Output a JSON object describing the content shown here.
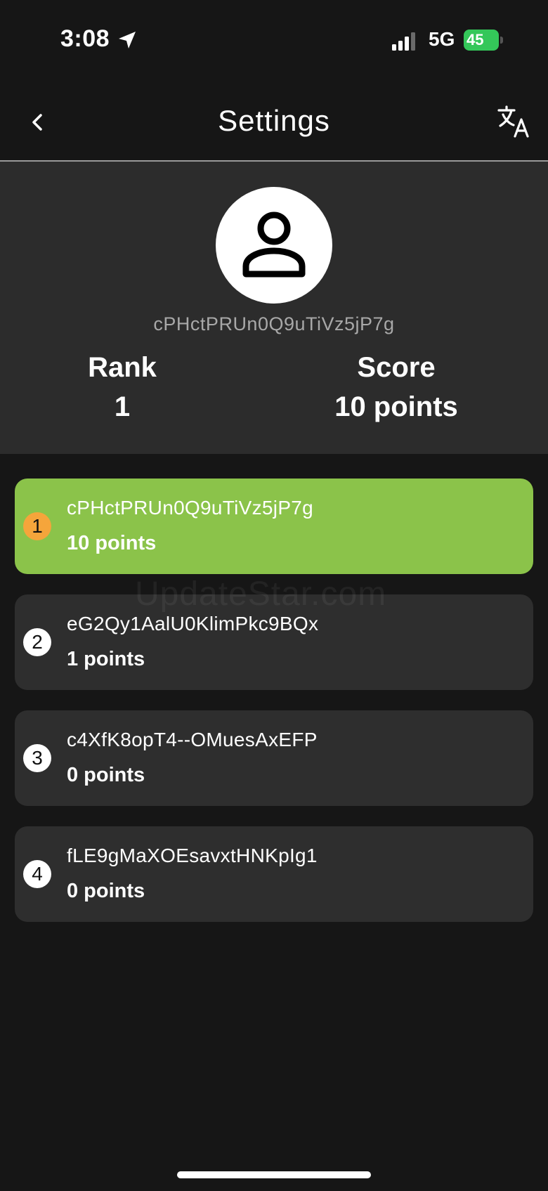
{
  "status_bar": {
    "time": "3:08",
    "network": "5G",
    "battery": "45"
  },
  "nav": {
    "title": "Settings",
    "back_icon": "chevron-left-icon",
    "translate_icon": "translate-icon"
  },
  "profile": {
    "avatar_icon": "person-icon",
    "user_id": "cPHctPRUn0Q9uTiVz5jP7g",
    "rank_label": "Rank",
    "rank_value": "1",
    "score_label": "Score",
    "score_value": "10 points"
  },
  "leaderboard": [
    {
      "rank": "1",
      "name": "cPHctPRUn0Q9uTiVz5jP7g",
      "points": "10 points",
      "highlight": true
    },
    {
      "rank": "2",
      "name": "eG2Qy1AalU0KlimPkc9BQx",
      "points": "1 points",
      "highlight": false
    },
    {
      "rank": "3",
      "name": "c4XfK8opT4--OMuesAxEFP",
      "points": "0 points",
      "highlight": false
    },
    {
      "rank": "4",
      "name": "fLE9gMaXOEsavxtHNKpIg1",
      "points": "0 points",
      "highlight": false
    }
  ],
  "watermark": "UpdateStar.com",
  "colors": {
    "highlight": "#8bc34a",
    "top_rank_badge": "#f5a53b",
    "card": "#2e2e2e",
    "background": "#161616"
  }
}
